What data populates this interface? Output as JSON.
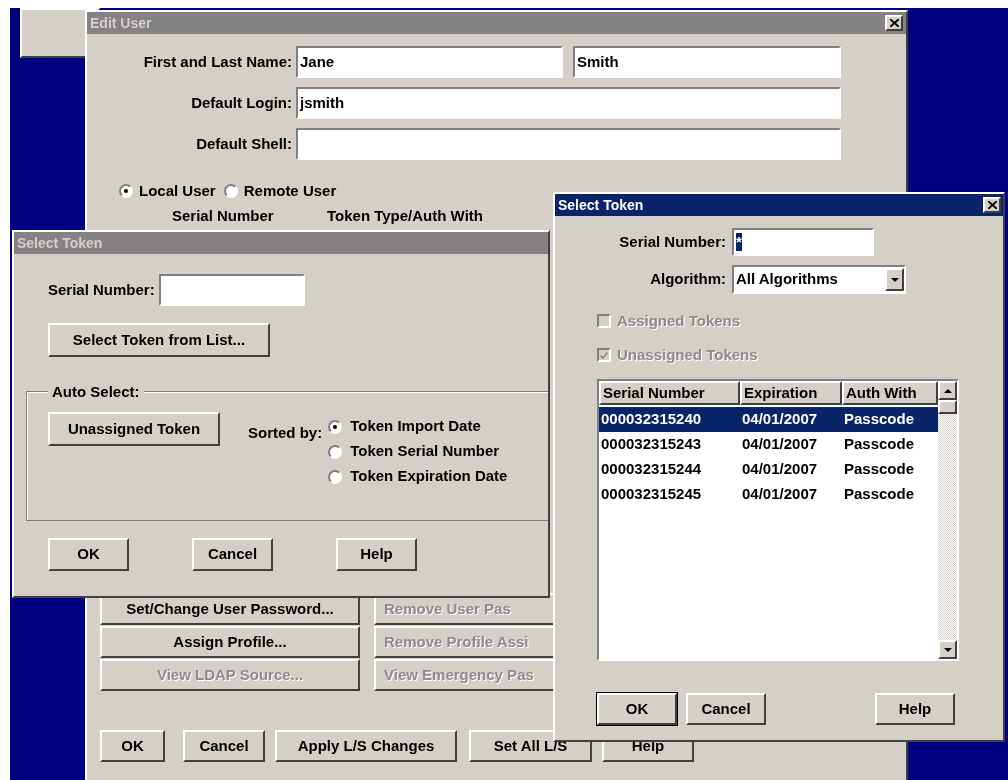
{
  "edit_user": {
    "title": "Edit User",
    "active": false,
    "name_label": "First and Last Name:",
    "first_name": "Jane",
    "last_name": "Smith",
    "login_label": "Default Login:",
    "login": "jsmith",
    "shell_label": "Default Shell:",
    "user_type": [
      {
        "label": "Local User",
        "selected": true
      },
      {
        "label": "Remote User",
        "selected": false
      }
    ],
    "token_columns": [
      "Serial Number",
      "Token Type/Auth With"
    ],
    "action_buttons": [
      {
        "label": "Set/Change User Password...",
        "disabled": false
      },
      {
        "label": "Remove User Pas",
        "disabled": true
      },
      {
        "label": "Assign Profile...",
        "disabled": false
      },
      {
        "label": "Remove Profile Assi",
        "disabled": true
      },
      {
        "label": "View LDAP Source...",
        "disabled": true
      },
      {
        "label": "View Emergency Pas",
        "disabled": true
      }
    ],
    "footer_buttons": [
      "OK",
      "Cancel",
      "Apply L/S Changes",
      "Set All L/S",
      "Help"
    ]
  },
  "select_token_auto": {
    "title": "Select Token",
    "active": false,
    "serial_label": "Serial Number:",
    "list_button": "Select Token from List...",
    "group_label": "Auto Select:",
    "unassigned_button": "Unassigned Token",
    "sorted_label": "Sorted by:",
    "sort_options": [
      {
        "label": "Token Import Date",
        "selected": true
      },
      {
        "label": "Token Serial Number",
        "selected": false
      },
      {
        "label": "Token Expiration Date",
        "selected": false
      }
    ],
    "buttons": [
      "OK",
      "Cancel",
      "Help"
    ]
  },
  "select_token_list": {
    "title": "Select Token",
    "active": true,
    "serial_label": "Serial Number:",
    "serial_value": "*",
    "algorithm_label": "Algorithm:",
    "algorithm_value": "All Algorithms",
    "filters": [
      {
        "label": "Assigned Tokens",
        "checked": false,
        "disabled": true
      },
      {
        "label": "Unassigned Tokens",
        "checked": true,
        "disabled": true
      }
    ],
    "columns": [
      "Serial Number",
      "Expiration",
      "Auth With"
    ],
    "rows": [
      {
        "cells": [
          "000032315240",
          "04/01/2007",
          "Passcode"
        ],
        "selected": true
      },
      {
        "cells": [
          "000032315243",
          "04/01/2007",
          "Passcode"
        ],
        "selected": false
      },
      {
        "cells": [
          "000032315244",
          "04/01/2007",
          "Passcode"
        ],
        "selected": false
      },
      {
        "cells": [
          "000032315245",
          "04/01/2007",
          "Passcode"
        ],
        "selected": false
      }
    ],
    "buttons": [
      {
        "label": "OK",
        "default": true
      },
      {
        "label": "Cancel",
        "default": false
      },
      {
        "label": "Help",
        "default": false
      }
    ]
  }
}
